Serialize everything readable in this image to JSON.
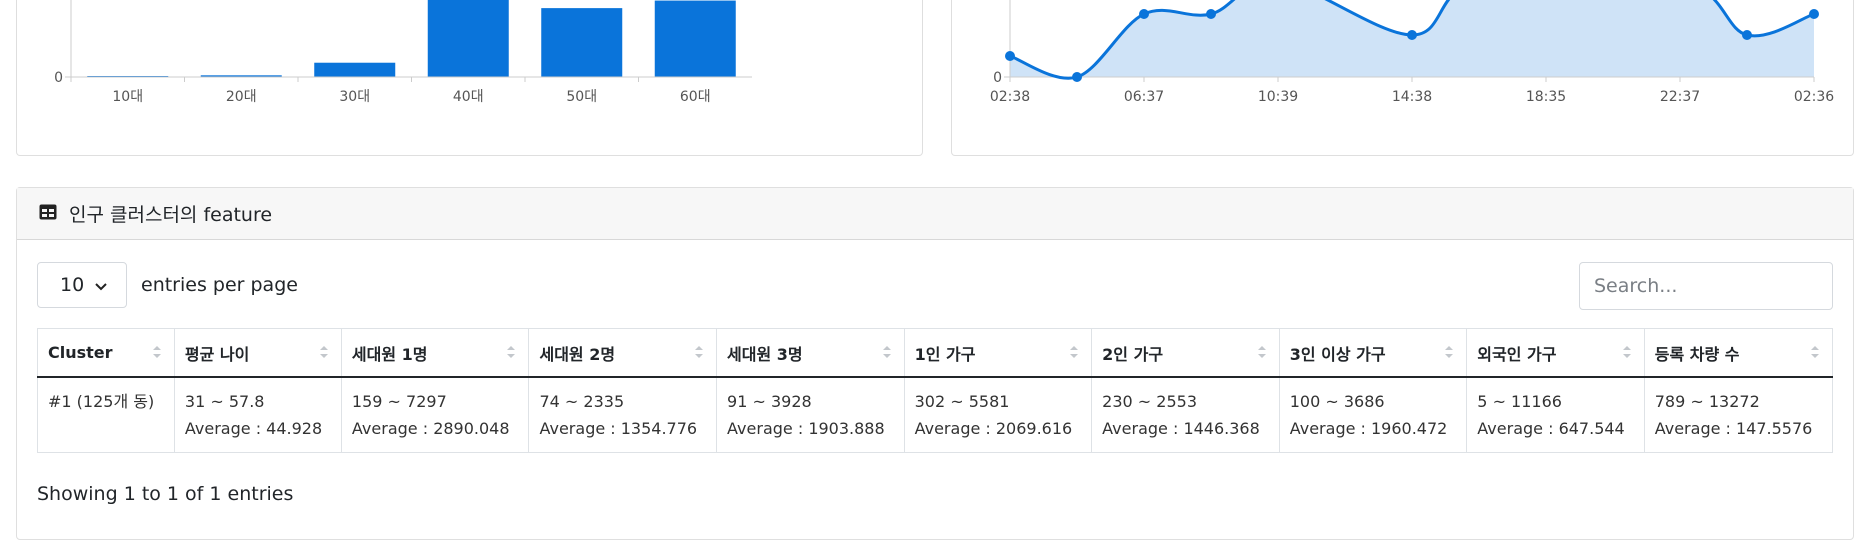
{
  "bar_chart": {
    "chart_data": {
      "type": "bar",
      "categories": [
        "10대",
        "20대",
        "30대",
        "40대",
        "50대",
        "60대"
      ],
      "values": [
        0,
        2,
        17,
        110,
        82,
        91
      ],
      "ylim": [
        0,
        100
      ],
      "y_ticks": [
        "0"
      ],
      "color": "#0a74da"
    }
  },
  "line_chart": {
    "chart_data": {
      "type": "area",
      "x_ticks": [
        "02:38",
        "06:37",
        "10:39",
        "14:38",
        "18:35",
        "22:37",
        "02:36"
      ],
      "points": [
        {
          "x": 0,
          "y": 25
        },
        {
          "x": 1,
          "y": 0
        },
        {
          "x": 2,
          "y": 75
        },
        {
          "x": 3,
          "y": 75
        },
        {
          "x": 4,
          "y": 115
        },
        {
          "x": 6,
          "y": 50
        },
        {
          "x": 7,
          "y": 115
        },
        {
          "x": 10,
          "y": 115
        },
        {
          "x": 11,
          "y": 50
        },
        {
          "x": 12,
          "y": 75
        }
      ],
      "xlim": [
        0,
        12
      ],
      "ylim": [
        0,
        100
      ],
      "y_ticks": [
        "0"
      ],
      "line_color": "#0a74da",
      "fill_color": "#cfe3f7"
    }
  },
  "table_card": {
    "title": "인구 클러스터의 feature",
    "page_size": "10",
    "entries_label": "entries per page",
    "search_placeholder": "Search...",
    "columns": [
      "Cluster",
      "평균 나이",
      "세대원 1명",
      "세대원 2명",
      "세대원 3명",
      "1인 가구",
      "2인 가구",
      "3인 이상 가구",
      "외국인 가구",
      "등록 차량 수"
    ],
    "rows": [
      {
        "cluster": "#1 (125개 동)",
        "cells": [
          {
            "range": "31 ~ 57.8",
            "avg": "Average : 44.928"
          },
          {
            "range": "159 ~ 7297",
            "avg": "Average : 2890.048"
          },
          {
            "range": "74 ~ 2335",
            "avg": "Average : 1354.776"
          },
          {
            "range": "91 ~ 3928",
            "avg": "Average : 1903.888"
          },
          {
            "range": "302 ~ 5581",
            "avg": "Average : 2069.616"
          },
          {
            "range": "230 ~ 2553",
            "avg": "Average : 1446.368"
          },
          {
            "range": "100 ~ 3686",
            "avg": "Average : 1960.472"
          },
          {
            "range": "5 ~ 11166",
            "avg": "Average : 647.544"
          },
          {
            "range": "789 ~ 13272",
            "avg": "Average : 147.5576"
          }
        ]
      }
    ],
    "footer": "Showing 1 to 1 of 1 entries"
  },
  "icons": {
    "table": "table-icon",
    "select": "chevron-down-icon",
    "sort": "sort-icon"
  }
}
